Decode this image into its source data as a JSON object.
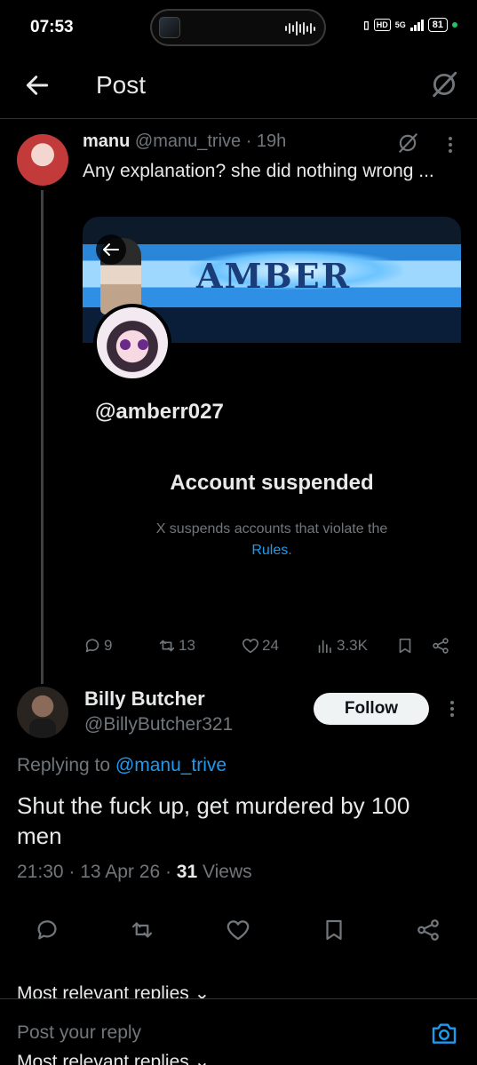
{
  "status_bar": {
    "time": "07:53",
    "hd": "HD",
    "net": "5G",
    "battery": "81"
  },
  "header": {
    "title": "Post",
    "back_icon": "arrow-left-icon",
    "grok_icon": "grok-icon"
  },
  "parent_post": {
    "name": "manu",
    "handle": "@manu_trive",
    "time": "· 19h",
    "text": "Any explanation? she did nothing wrong ...",
    "card": {
      "banner_text": "AMBER",
      "handle": "@amberr027",
      "suspended_title": "Account suspended",
      "suspended_desc": "X suspends accounts that violate the",
      "rules_link": "Rules",
      "rules_suffix": "."
    },
    "stats": {
      "replies": "9",
      "reposts": "13",
      "likes": "24",
      "views": "3.3K"
    }
  },
  "reply": {
    "name": "Billy Butcher",
    "handle": "@BillyButcher321",
    "follow_label": "Follow",
    "replying_prefix": "Replying to",
    "replying_to": "@manu_trive",
    "text": "Shut the fuck up, get murdered by 100 men",
    "time": "21:30 · 13 Apr 26 ·",
    "views_count": "31",
    "views_label": "Views"
  },
  "sort_label": "Most relevant replies",
  "composer": {
    "placeholder": "Post your reply"
  },
  "colors": {
    "accent": "#1d9bf0",
    "muted": "#71767b",
    "text": "#e7e9ea",
    "bg": "#000000"
  }
}
